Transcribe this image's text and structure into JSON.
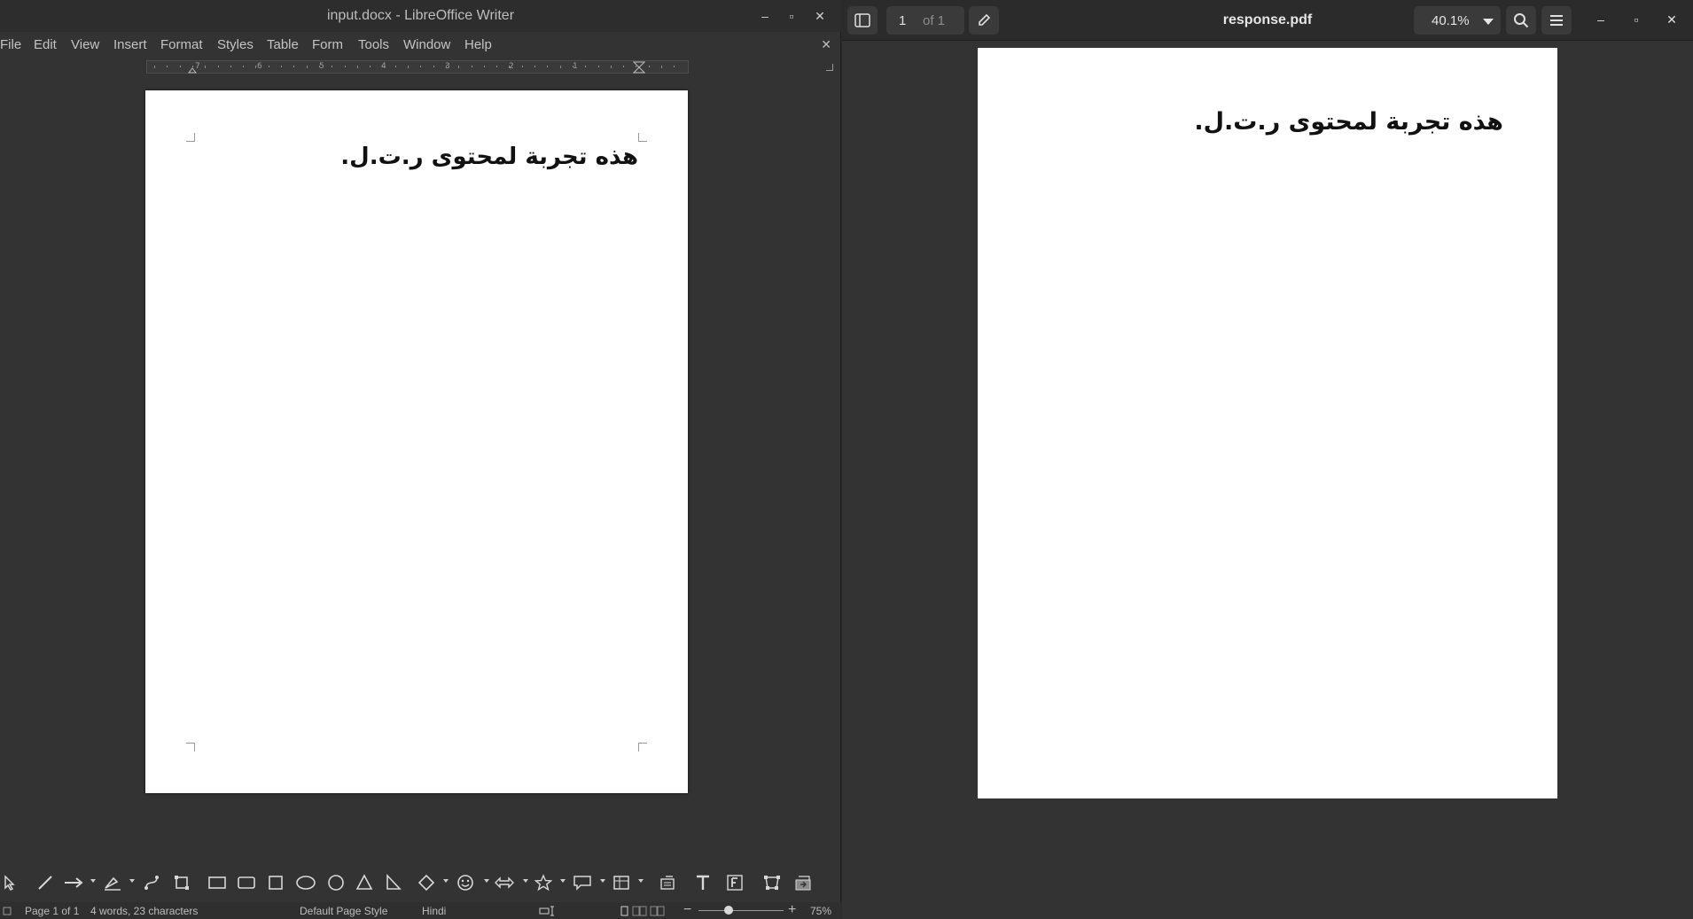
{
  "writer": {
    "window_title": "input.docx - LibreOffice Writer",
    "menu": [
      "File",
      "Edit",
      "View",
      "Insert",
      "Format",
      "Styles",
      "Table",
      "Form",
      "Tools",
      "Window",
      "Help"
    ],
    "ruler_numbers": [
      "7",
      "6",
      "5",
      "4",
      "3",
      "2",
      "1"
    ],
    "document_text": "هذه تجربة لمحتوى ر.ت.ل.",
    "status": {
      "page": "Page 1 of 1",
      "words": "4 words, 23 characters",
      "page_style": "Default Page Style",
      "language": "Hindi",
      "zoom": "75%"
    },
    "toolbar_tools": [
      "select-tool",
      "line-tool",
      "arrow-line-tool",
      "curve-tool",
      "connector-tool",
      "transformation-tool",
      "rectangle-tool",
      "rounded-rectangle-tool",
      "square-tool",
      "ellipse-tool",
      "circle-tool",
      "triangle-tool",
      "right-triangle-tool",
      "basic-shapes-tool",
      "symbol-shapes-tool",
      "block-arrows-tool",
      "stars-tool",
      "callouts-tool",
      "table-tool",
      "text-wrap-tool",
      "text-box-tool",
      "fontwork-tool",
      "points-tool",
      "toggle-extrusion-tool"
    ]
  },
  "viewer": {
    "title": "response.pdf",
    "page_number": "1",
    "page_of": "of 1",
    "zoom": "40.1%",
    "document_text": "هذه تجربة لمحتوى ر.ت.ل."
  },
  "colors": {
    "window_bg": "#333333",
    "titlebar_bg": "#2d2d2d",
    "page_bg": "#ffffff",
    "text_dark": "#111111"
  }
}
